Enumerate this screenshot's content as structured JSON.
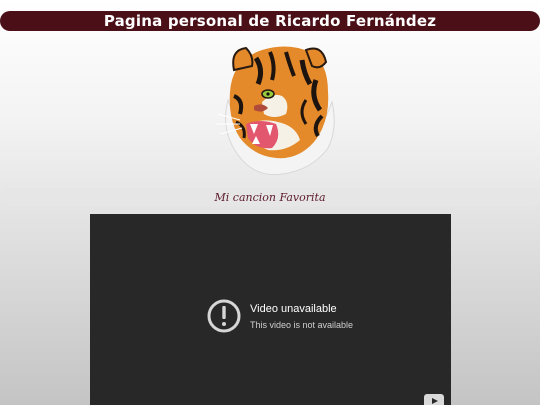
{
  "header": {
    "title": "Pagina personal de Ricardo Fernández"
  },
  "colors": {
    "header_bg": "#4a0f17",
    "song_text": "#5c1a2a",
    "video_bg": "#282828"
  },
  "image": {
    "icon": "tiger-head-image"
  },
  "song": {
    "label": "Mi cancion Favorita"
  },
  "video": {
    "title": "Video unavailable",
    "subtitle": "This video is not available",
    "status_icon": "warning-icon",
    "brand_icon": "youtube-icon"
  }
}
